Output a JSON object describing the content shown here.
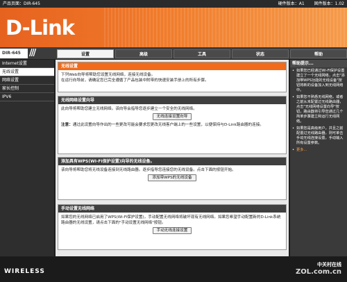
{
  "topbar": {
    "product_page": "产品页面：DIR-645",
    "hardware": "硬件版本：A1",
    "firmware": "固件版本：1.02"
  },
  "brand": {
    "logo": "D-Link",
    "footer": "WIRELESS"
  },
  "model": "DIR-645",
  "tabs": [
    {
      "label": "设置"
    },
    {
      "label": "高级"
    },
    {
      "label": "工具"
    },
    {
      "label": "状态"
    },
    {
      "label": "帮助"
    }
  ],
  "sidebar": {
    "items": [
      {
        "label": "Internet设置"
      },
      {
        "label": "无线设置"
      },
      {
        "label": "网络设置"
      },
      {
        "label": "家长控制"
      },
      {
        "label": "IPV6"
      }
    ]
  },
  "main": {
    "wireless": {
      "title": "无线设置",
      "line1": "下列Web向导将帮助您设置无线网络，连接无线设备。",
      "line2": "在运行向导前，请确定您已完全遵循了产品包装中附带的快速安装手册上的所有步骤。"
    },
    "wizard": {
      "title": "无线网络设置向导",
      "text": "此向导将帮助您建立无线网络。该向导会指导您逐步建立一个安全的无线网络。",
      "button": "无线连接设置向导",
      "note_label": "注意：",
      "note_text": "通过此设置向导作出的一些更改可能会要求您更改无线客户端上的一些设置，以便保持与D-Link路由器的连接。"
    },
    "wps": {
      "title": "添加具有WPS(WI-FI保护设置)向导的无线设备。",
      "text": "该向导将帮助您将无线设备连接到无线路由器。逐步指导您连接您的无线设备。点击下面的按钮开始。",
      "button": "添加带WPS的无线设备"
    },
    "manual": {
      "title": "手动设置无线网络",
      "text": "如果您的无线网络已启用了WPS(Wi-Fi保护设置)，手动配置无线网络将破坏现有无线网络。如果您希望手动配置新的D-Link系统路由器的无线设置，请点击下面的\"手动设置无线网络\"按钮。",
      "button": "手动无线连接设置"
    }
  },
  "help": {
    "title": "帮助提示...",
    "tips": [
      "如果您已经通过Wi-Fi保护设置建立了一个无线网络，点击\"添加带WPS功能的无线设备\"按钮将新的设备加入到无线网络中。",
      "如果您不熟悉无线网络，或者之前从未配置过无线路由器，点击\"无线网络设置向导\"按钮，路由器将引导您通过几个简单步骤建立和运行无线网络。",
      "如果您是高级用户，并且之前配置过无线路由器，则可单击 手动无线连接设置，手动输入所有设置参数。"
    ],
    "more": "更多..."
  },
  "watermark": {
    "site": "中关村在线",
    "domain": "ZOL.com.cn"
  },
  "colors": {
    "accent": "#f16b1a",
    "banner": "#e6621f",
    "dark": "#3f3f3f"
  }
}
